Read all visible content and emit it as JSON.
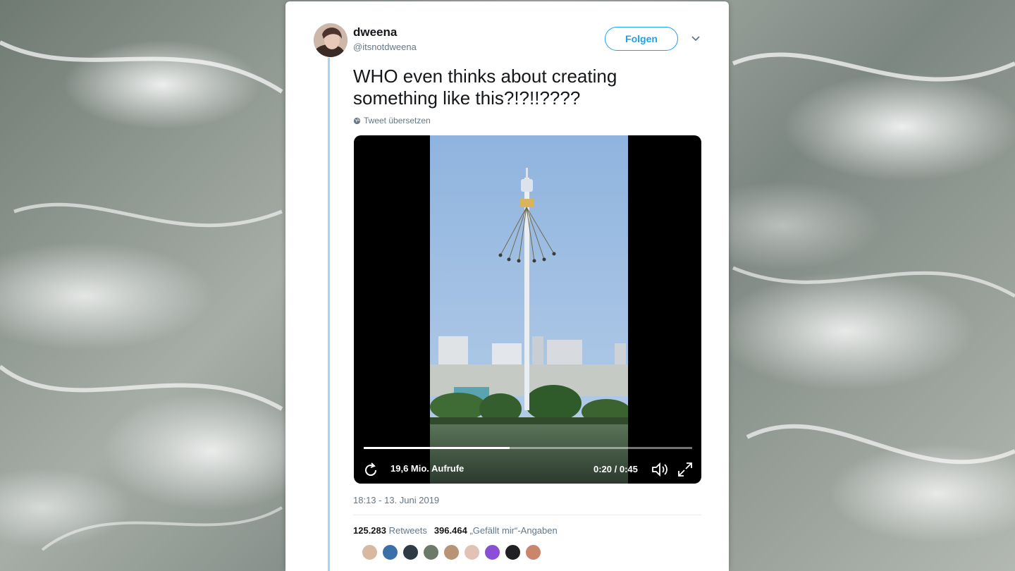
{
  "user": {
    "name": "dweena",
    "handle": "@itsnotdweena"
  },
  "follow_label": "Folgen",
  "tweet": {
    "text_line1": "WHO even thinks about creating",
    "text_line2": "something like this?!?!!????",
    "translate_label": "Tweet übersetzen"
  },
  "video": {
    "views": "19,6 Mio. Aufrufe",
    "time": "0:20 / 0:45",
    "progress_fraction": 0.444
  },
  "timestamp": "18:13 - 13. Juni 2019",
  "stats": {
    "retweets_count": "125.283",
    "retweets_label": "Retweets",
    "likes_count": "396.464",
    "likes_label": "„Gefällt mir“-Angaben"
  },
  "liker_avatars": [
    {
      "name": "liker-avatar-1",
      "color": "#d9b8a0"
    },
    {
      "name": "liker-avatar-2",
      "color": "#3b6fa8"
    },
    {
      "name": "liker-avatar-3",
      "color": "#2e3b46"
    },
    {
      "name": "liker-avatar-4",
      "color": "#6d7a6a"
    },
    {
      "name": "liker-avatar-5",
      "color": "#b79474"
    },
    {
      "name": "liker-avatar-6",
      "color": "#e3c2b5"
    },
    {
      "name": "liker-avatar-7",
      "color": "#8a4fd6"
    },
    {
      "name": "liker-avatar-8",
      "color": "#1f1f24"
    },
    {
      "name": "liker-avatar-9",
      "color": "#c9866c"
    }
  ],
  "colors": {
    "accent": "#1da1f2",
    "thread_line": "#a8d3f2",
    "muted_text": "#657786"
  }
}
